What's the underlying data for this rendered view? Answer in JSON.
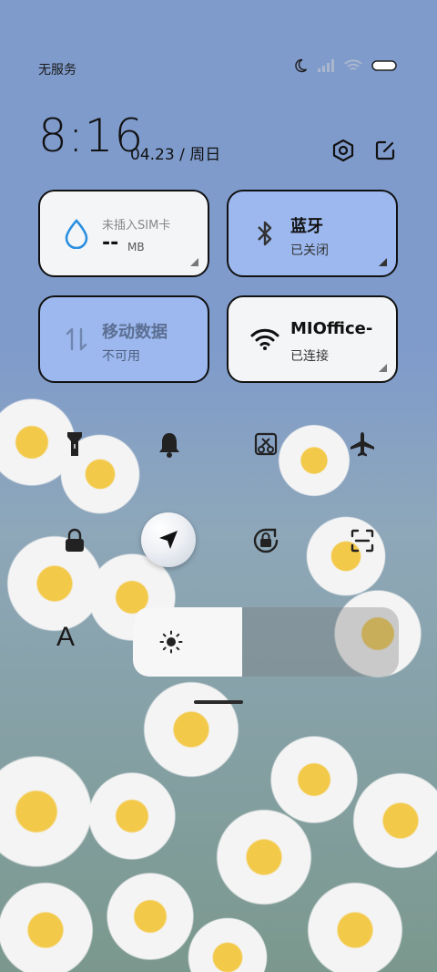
{
  "status_bar": {
    "carrier": "无服务",
    "icons": [
      "moon-icon",
      "signal-icon",
      "wifi-icon",
      "battery-icon"
    ]
  },
  "header": {
    "time": "8:16",
    "date": "04.23 / 周日",
    "settings_icon": "settings-hexagon-icon",
    "edit_icon": "edit-icon"
  },
  "tiles": {
    "data_usage": {
      "title": "未插入SIM卡",
      "value": "--",
      "unit": "MB",
      "icon": "water-drop-icon"
    },
    "bluetooth": {
      "title": "蓝牙",
      "status": "已关闭",
      "icon": "bluetooth-icon"
    },
    "mobile_data": {
      "title": "移动数据",
      "status": "不可用",
      "icon": "data-arrows-icon"
    },
    "wifi": {
      "title": "MIOffice-",
      "status": "已连接",
      "icon": "wifi-icon"
    }
  },
  "toggles_row1": [
    "flashlight-icon",
    "bell-icon",
    "screenshot-icon",
    "airplane-icon"
  ],
  "toggles_row2": [
    "lock-icon",
    "location-icon",
    "rotation-lock-icon",
    "scan-icon"
  ],
  "brightness": {
    "level_percent": 41,
    "icon": "sun-icon"
  },
  "font_size_label": "A",
  "colors": {
    "background": "#7f9bcc",
    "tile_active": "#9cb8ee",
    "tile_inactive": "#f4f5f7"
  }
}
